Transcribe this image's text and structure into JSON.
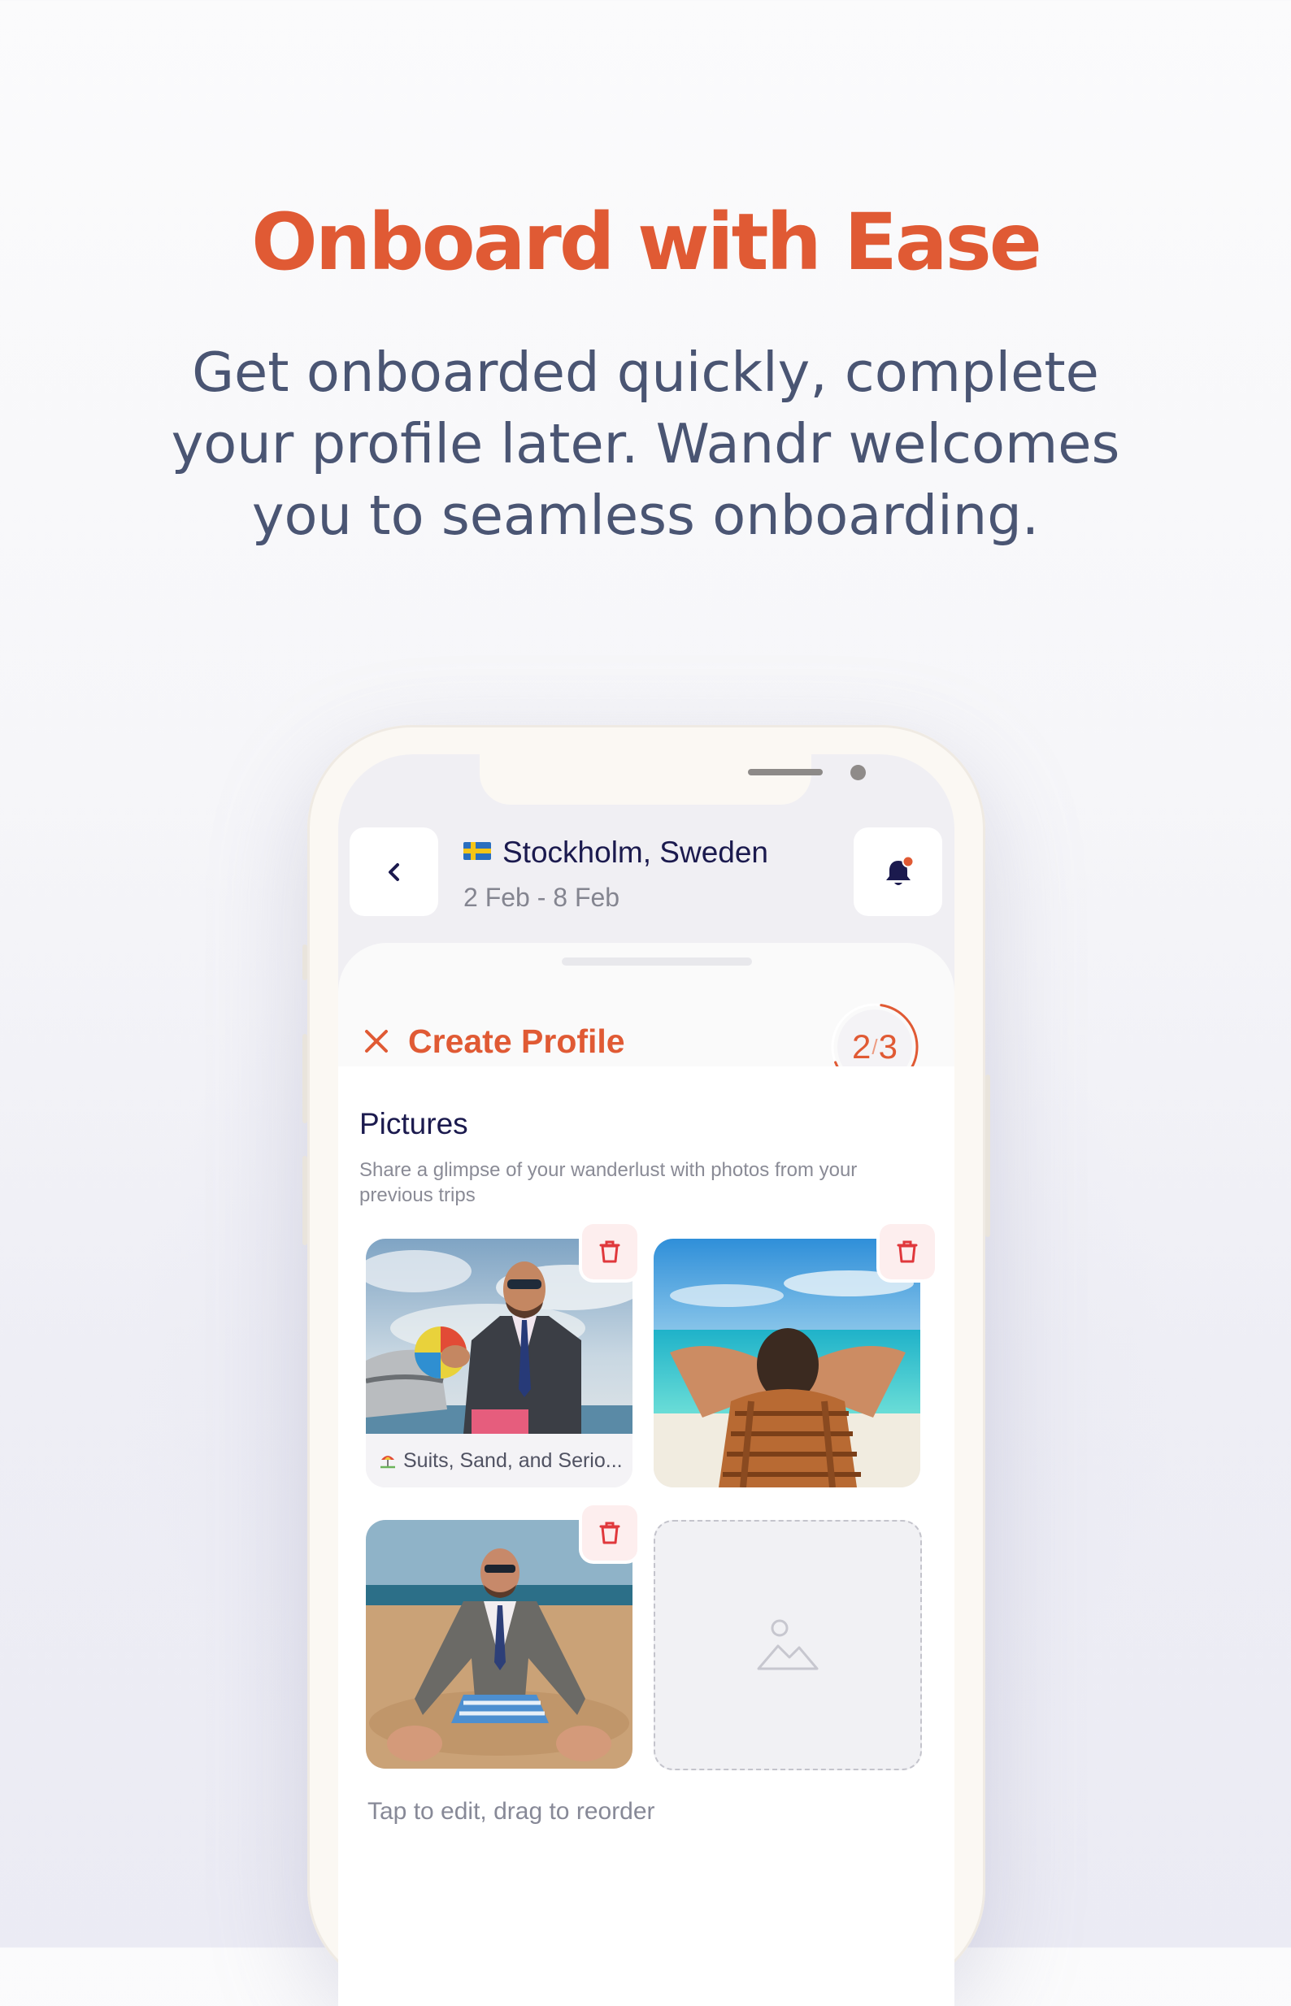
{
  "hero": {
    "title": "Onboard with Ease",
    "subtitle": "Get onboarded quickly, complete your profile later. Wandr welcomes you to seamless onboarding."
  },
  "header": {
    "back_icon": "chevron-left-icon",
    "flag": "sweden-flag",
    "location": "Stockholm, Sweden",
    "dates": "2 Feb - 8 Feb",
    "notification_icon": "bell-icon",
    "notification_dot_color": "#e05a34"
  },
  "profile": {
    "close_icon": "close-icon",
    "title": "Create Profile",
    "step_current": "2",
    "step_separator": "/",
    "step_total": "3",
    "progress_fraction": 0.6667
  },
  "pictures": {
    "title": "Pictures",
    "description": "Share a glimpse of your wanderlust with photos from your previous trips",
    "photos": [
      {
        "caption": "Suits, Sand, and Serio...",
        "caption_icon": "beach-umbrella-icon",
        "delete_icon": "trash-icon"
      },
      {
        "caption": "",
        "delete_icon": "trash-icon"
      },
      {
        "caption": "",
        "delete_icon": "trash-icon"
      }
    ],
    "empty_slot_icon": "image-placeholder-icon",
    "hint": "Tap to edit, drag to reorder"
  },
  "colors": {
    "accent": "#e05a34",
    "navy": "#1b1a4e",
    "delete_bg": "#fdeeee",
    "delete_icon": "#e0383c"
  }
}
